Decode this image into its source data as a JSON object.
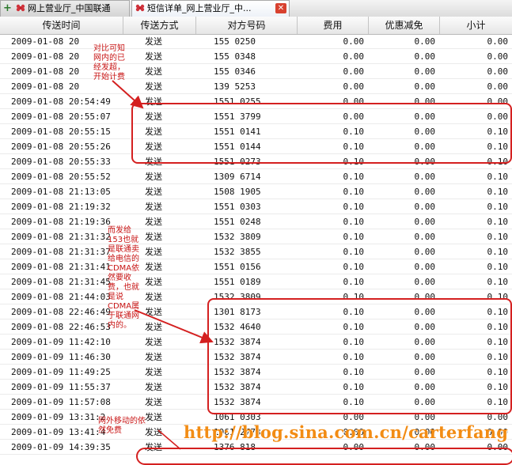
{
  "tabs": [
    {
      "label": "网上营业厅_中国联通",
      "icon": "flower-icon"
    },
    {
      "label": "短信详单_网上营业厅_中...",
      "icon": "flower-icon",
      "active": true
    }
  ],
  "columns": [
    "传送时间",
    "传送方式",
    "对方号码",
    "费用",
    "优惠减免",
    "小计"
  ],
  "rows": [
    {
      "time": "2009-01-08 20",
      "method": "发送",
      "number": "155  0250",
      "fee": "0.00",
      "discount": "0.00",
      "subtotal": "0.00"
    },
    {
      "time": "2009-01-08 20",
      "method": "发送",
      "number": "155  0348",
      "fee": "0.00",
      "discount": "0.00",
      "subtotal": "0.00"
    },
    {
      "time": "2009-01-08 20",
      "method": "发送",
      "number": "155  0346",
      "fee": "0.00",
      "discount": "0.00",
      "subtotal": "0.00"
    },
    {
      "time": "2009-01-08 20",
      "method": "发送",
      "number": "139  5253",
      "fee": "0.00",
      "discount": "0.00",
      "subtotal": "0.00"
    },
    {
      "time": "2009-01-08 20:54:49",
      "method": "发送",
      "number": "1551    0255",
      "fee": "0.00",
      "discount": "0.00",
      "subtotal": "0.00"
    },
    {
      "time": "2009-01-08 20:55:07",
      "method": "发送",
      "number": "1551    3799",
      "fee": "0.00",
      "discount": "0.00",
      "subtotal": "0.00"
    },
    {
      "time": "2009-01-08 20:55:15",
      "method": "发送",
      "number": "1551    0141",
      "fee": "0.10",
      "discount": "0.00",
      "subtotal": "0.10"
    },
    {
      "time": "2009-01-08 20:55:26",
      "method": "发送",
      "number": "1551    0144",
      "fee": "0.10",
      "discount": "0.00",
      "subtotal": "0.10"
    },
    {
      "time": "2009-01-08 20:55:33",
      "method": "发送",
      "number": "1551    0273",
      "fee": "0.10",
      "discount": "0.00",
      "subtotal": "0.10"
    },
    {
      "time": "2009-01-08 20:55:52",
      "method": "发送",
      "number": "1309    6714",
      "fee": "0.10",
      "discount": "0.00",
      "subtotal": "0.10"
    },
    {
      "time": "2009-01-08 21:13:05",
      "method": "发送",
      "number": "1508    1905",
      "fee": "0.10",
      "discount": "0.00",
      "subtotal": "0.10"
    },
    {
      "time": "2009-01-08 21:19:32",
      "method": "发送",
      "number": "1551    0303",
      "fee": "0.10",
      "discount": "0.00",
      "subtotal": "0.10"
    },
    {
      "time": "2009-01-08 21:19:36",
      "method": "发送",
      "number": "1551    0248",
      "fee": "0.10",
      "discount": "0.00",
      "subtotal": "0.10"
    },
    {
      "time": "2009-01-08 21:31:32",
      "method": "发送",
      "number": "1532    3809",
      "fee": "0.10",
      "discount": "0.00",
      "subtotal": "0.10"
    },
    {
      "time": "2009-01-08 21:31:37",
      "method": "发送",
      "number": "1532    3855",
      "fee": "0.10",
      "discount": "0.00",
      "subtotal": "0.10"
    },
    {
      "time": "2009-01-08 21:31:41",
      "method": "发送",
      "number": "1551    0156",
      "fee": "0.10",
      "discount": "0.00",
      "subtotal": "0.10"
    },
    {
      "time": "2009-01-08 21:31:45",
      "method": "发送",
      "number": "1551    0189",
      "fee": "0.10",
      "discount": "0.00",
      "subtotal": "0.10"
    },
    {
      "time": "2009-01-08 21:44:03",
      "method": "发送",
      "number": "1532    3809",
      "fee": "0.10",
      "discount": "0.00",
      "subtotal": "0.10"
    },
    {
      "time": "2009-01-08 22:46:49",
      "method": "发送",
      "number": "1301    8173",
      "fee": "0.10",
      "discount": "0.00",
      "subtotal": "0.10"
    },
    {
      "time": "2009-01-08 22:46:53",
      "method": "发送",
      "number": "1532    4640",
      "fee": "0.10",
      "discount": "0.00",
      "subtotal": "0.10"
    },
    {
      "time": "2009-01-09 11:42:10",
      "method": "发送",
      "number": "1532    3874",
      "fee": "0.10",
      "discount": "0.00",
      "subtotal": "0.10"
    },
    {
      "time": "2009-01-09 11:46:30",
      "method": "发送",
      "number": "1532    3874",
      "fee": "0.10",
      "discount": "0.00",
      "subtotal": "0.10"
    },
    {
      "time": "2009-01-09 11:49:25",
      "method": "发送",
      "number": "1532    3874",
      "fee": "0.10",
      "discount": "0.00",
      "subtotal": "0.10"
    },
    {
      "time": "2009-01-09 11:55:37",
      "method": "发送",
      "number": "1532    3874",
      "fee": "0.10",
      "discount": "0.00",
      "subtotal": "0.10"
    },
    {
      "time": "2009-01-09 11:57:08",
      "method": "发送",
      "number": "1532    3874",
      "fee": "0.10",
      "discount": "0.00",
      "subtotal": "0.10"
    },
    {
      "time": "2009-01-09 13:31:2",
      "method": "发送",
      "number": "1061    0303",
      "fee": "0.00",
      "discount": "0.00",
      "subtotal": "0.00"
    },
    {
      "time": "2009-01-09 13:41:4",
      "method": "发送",
      "number": "1061    2773",
      "fee": "0.00",
      "discount": "0.00",
      "subtotal": "0.00"
    },
    {
      "time": "2009-01-09 14:39:35",
      "method": "发送",
      "number": "1376    818",
      "fee": "0.00",
      "discount": "0.00",
      "subtotal": "0.00"
    }
  ],
  "annotations": {
    "note1": "对比可知网内的已经发超，开始计费",
    "note2": "而发给153也就是联通卖给电信的CDMA依然要收费，也就是说CDMA属于联通网内的。",
    "note3": "网外移动的依然免费"
  },
  "watermark": "http://blog.sina.com.cn/carterfang",
  "colors": {
    "annotation": "#d42020",
    "watermark": "#f28c14",
    "header": "#e6e6e6"
  }
}
